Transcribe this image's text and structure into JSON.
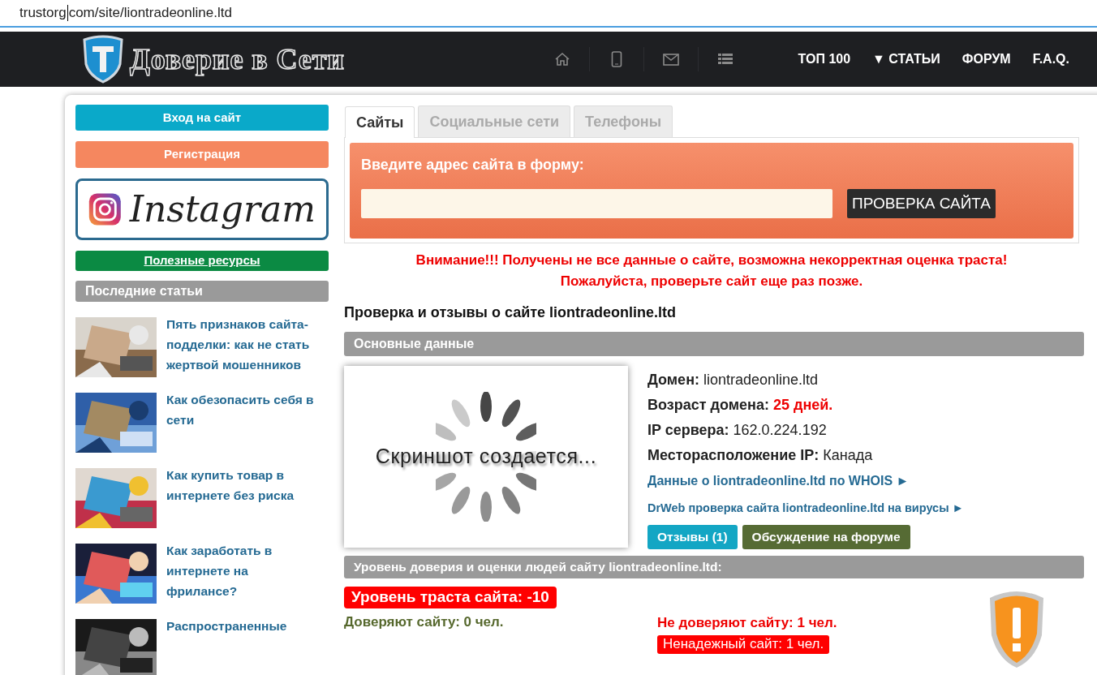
{
  "address_bar": {
    "text_before_cursor": "trustorg",
    "text_after_cursor": "com/site/liontradeonline.ltd"
  },
  "header": {
    "logo_text": "Доверие в Сети",
    "nav": [
      {
        "label": "ТОП 100"
      },
      {
        "label": "▼ СТАТЬИ"
      },
      {
        "label": "ФОРУМ"
      },
      {
        "label": "F.A.Q."
      }
    ]
  },
  "sidebar": {
    "login_button": "Вход на сайт",
    "register_button": "Регистрация",
    "instagram_banner": "Instagram",
    "resources_link": "Полезные ресурсы",
    "articles_title": "Последние статьи",
    "articles": [
      {
        "title": "Пять признаков сайта-подделки: как не стать жертвой мошенников"
      },
      {
        "title": "Как обезопасить себя в сети"
      },
      {
        "title": "Как купить товар в интернете без риска"
      },
      {
        "title": "Как заработать в интернете на фрилансе?"
      },
      {
        "title": "Распространенные"
      }
    ]
  },
  "tabs": [
    {
      "label": "Сайты",
      "selected": true
    },
    {
      "label": "Социальные сети",
      "selected": false
    },
    {
      "label": "Телефоны",
      "selected": false
    }
  ],
  "check_form": {
    "title": "Введите адрес сайта в форму:",
    "button": "ПРОВЕРКА САЙТА"
  },
  "warning": [
    "Внимание!!! Получены не все данные о сайте, возможна некорректная оценка траста!",
    "Пожалуйста, проверьте сайт еще раз позже."
  ],
  "page_title": "Проверка и отзывы о сайте liontradeonline.ltd",
  "basic_section": {
    "title": "Основные данные",
    "screenshot_caption": "Скриншот создается...",
    "facts": [
      {
        "label": "Домен:",
        "value": "liontradeonline.ltd",
        "highlight": false
      },
      {
        "label": "Возраст домена:",
        "value": "25 дней.",
        "highlight": true
      },
      {
        "label": "IP сервера:",
        "value": "162.0.224.192",
        "highlight": false
      },
      {
        "label": "Месторасположение IP:",
        "value": "Канада",
        "highlight": false
      }
    ],
    "links": [
      "Данные о liontradeonline.ltd по WHOIS ►",
      "DrWeb проверка сайта liontradeonline.ltd на вирусы ►"
    ],
    "reviews_button": "Отзывы (1)",
    "forum_button": "Обсуждение на форуме"
  },
  "trust_section": {
    "title": "Уровень доверия и оценки людей сайту liontradeonline.ltd:",
    "trust_level": "Уровень траста сайта: -10",
    "trust_count": "Доверяют сайту: 0 чел.",
    "distrust_count": "Не доверяют сайту: 1 чел.",
    "unreliable_badge": "Ненадежный сайт: 1 чел."
  }
}
